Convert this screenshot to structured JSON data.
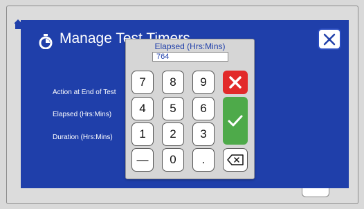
{
  "dialog": {
    "title": "Manage Test Timers",
    "close_icon": "close-icon",
    "title_icon": "stopwatch-icon",
    "fields": [
      {
        "label": "Action at End of Test"
      },
      {
        "label": "Elapsed (Hrs:Mins)"
      },
      {
        "label": "Duration (Hrs:Mins)"
      }
    ]
  },
  "keypad": {
    "label": "Elapsed (Hrs:Mins)",
    "value": "764",
    "keys": [
      "7",
      "8",
      "9",
      "4",
      "5",
      "6",
      "1",
      "2",
      "3",
      "—",
      "0",
      "."
    ],
    "cancel_icon": "x-icon",
    "enter_icon": "checkmark-icon",
    "backspace_icon": "backspace-icon"
  },
  "colors": {
    "dialog_bg": "#1f3faa",
    "cancel": "#e22a2a",
    "enter": "#4eaa4a"
  }
}
